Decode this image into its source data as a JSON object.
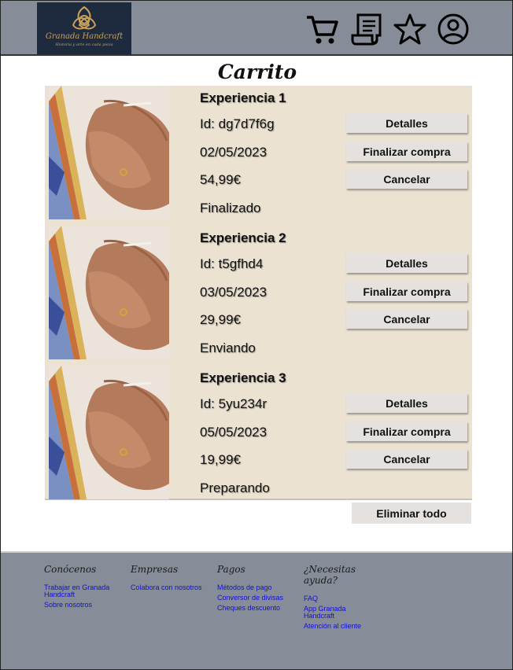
{
  "header": {
    "logo_title": "Granada Handcraft",
    "logo_subtitle": "Historia y arte en cada pieza",
    "icons": [
      "cart-icon",
      "receipt-icon",
      "star-icon",
      "user-icon"
    ]
  },
  "page_title": "Carrito",
  "cart": {
    "items": [
      {
        "name": "Experiencia 1",
        "id": "Id: dg7d7f6g",
        "date": "02/05/2023",
        "price": "54,99€",
        "status": "Finalizado"
      },
      {
        "name": "Experiencia 2",
        "id": "Id: t5gfhd4",
        "date": "03/05/2023",
        "price": "29,99€",
        "status": "Enviando"
      },
      {
        "name": "Experiencia 3",
        "id": "Id: 5yu234r",
        "date": "05/05/2023",
        "price": "19,99€",
        "status": "Preparando"
      }
    ],
    "buttons": {
      "details": "Detalles",
      "checkout": "Finalizar compra",
      "cancel": "Cancelar"
    },
    "delete_all": "Eliminar todo"
  },
  "footer": {
    "columns": [
      {
        "title": "Conócenos",
        "links": [
          "Trabajar en Granada Handcraft",
          "Sobre nosotros"
        ]
      },
      {
        "title": "Empresas",
        "links": [
          "Colabora con nosotros"
        ]
      },
      {
        "title": "Pagos",
        "links": [
          "Métodos de pago",
          "Conversor de divisas",
          "Cheques descuento"
        ]
      },
      {
        "title": "¿Necesitas ayuda?",
        "links": [
          "FAQ",
          "App Granada Handcraft",
          "Atención al cliente"
        ]
      }
    ]
  },
  "colors": {
    "header_bg": "#878d98",
    "cart_bg": "#ebe2d2",
    "button_bg": "#e4e1de",
    "link": "#1010d0",
    "logo_bg": "#1e2a3d",
    "logo_gold": "#c9a15a"
  }
}
